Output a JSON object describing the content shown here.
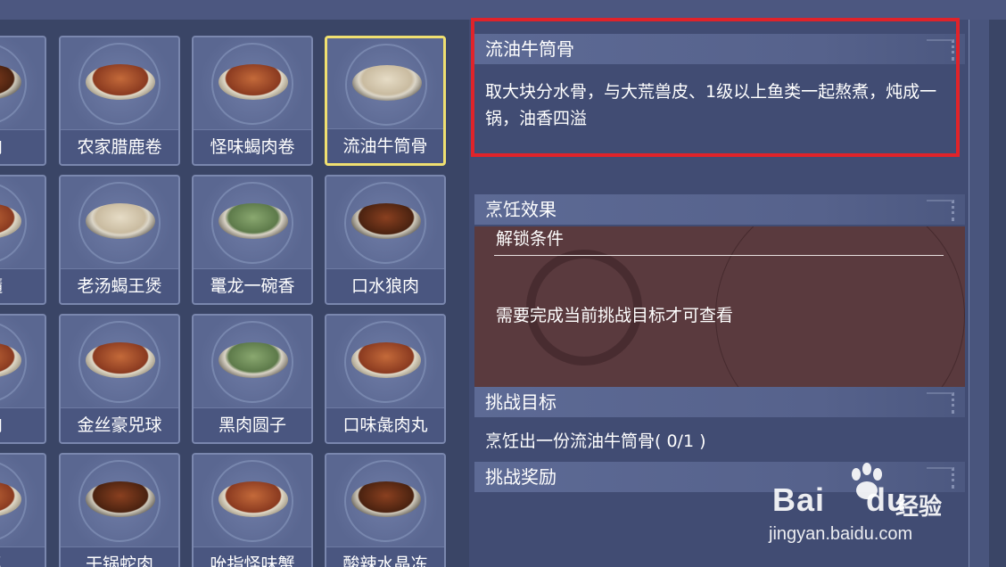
{
  "dish_grid": {
    "rows": [
      [
        "鳄肉",
        "农家腊鹿卷",
        "怪味蝎肉卷",
        "流油牛筒骨"
      ],
      [
        "脊髓",
        "老汤蝎王煲",
        "鼍龙一碗香",
        "口水狼肉"
      ],
      [
        "禄肉",
        "金丝豪兕球",
        "黑肉圆子",
        "口味彘肉丸"
      ],
      [
        "鸡爪",
        "干锅蛇肉",
        "吮指怪味蟹",
        "酸辣水晶冻"
      ]
    ],
    "selected": "流油牛筒骨"
  },
  "detail": {
    "title": "流油牛筒骨",
    "description": "取大块分水骨，与大荒兽皮、1级以上鱼类一起熬煮，炖成一锅，油香四溢"
  },
  "cooking_effect": {
    "header": "烹饪效果",
    "lock_title": "解锁条件",
    "lock_message": "需要完成当前挑战目标才可查看"
  },
  "challenge_goal": {
    "header": "挑战目标",
    "text": "烹饪出一份流油牛筒骨( 0/1 )"
  },
  "challenge_reward": {
    "header": "挑战奖励"
  },
  "watermark": {
    "brand_left": "Bai",
    "brand_right": "du",
    "brand_suffix": "经验",
    "url": "jingyan.baidu.com"
  },
  "colors": {
    "selected_border": "#f0e070",
    "highlight_box": "#e0232a",
    "lock_bg": "#5a3a3e"
  }
}
